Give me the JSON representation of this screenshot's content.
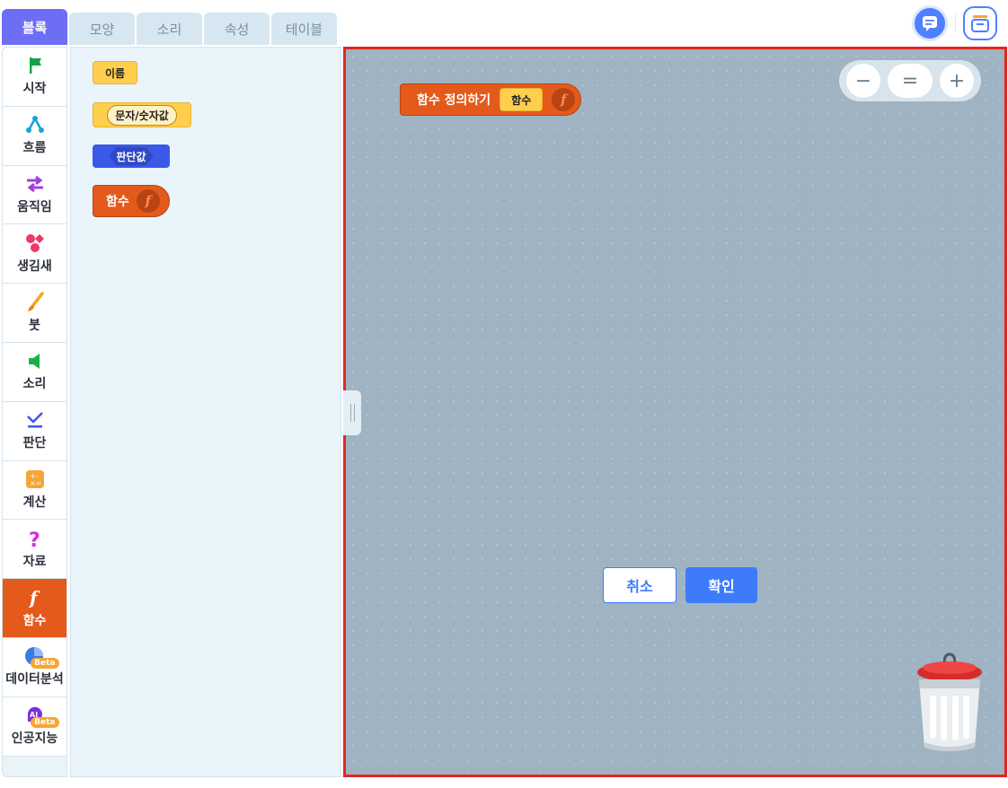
{
  "tabs": [
    {
      "label": "블록",
      "active": true
    },
    {
      "label": "모양"
    },
    {
      "label": "소리"
    },
    {
      "label": "속성"
    },
    {
      "label": "테이블"
    }
  ],
  "categories": [
    {
      "label": "시작",
      "icon": "flag-icon"
    },
    {
      "label": "흐름",
      "icon": "flow-icon"
    },
    {
      "label": "움직임",
      "icon": "arrows-icon"
    },
    {
      "label": "생김새",
      "icon": "shapes-icon"
    },
    {
      "label": "붓",
      "icon": "brush-icon"
    },
    {
      "label": "소리",
      "icon": "speaker-icon"
    },
    {
      "label": "판단",
      "icon": "check-icon"
    },
    {
      "label": "계산",
      "icon": "calculator-icon"
    },
    {
      "label": "자료",
      "icon": "question-icon"
    },
    {
      "label": "함수",
      "icon": "function-icon",
      "active": true
    },
    {
      "label": "데이터분석",
      "icon": "pie-chart-icon",
      "badge": "Beta"
    },
    {
      "label": "인공지능",
      "icon": "ai-head-icon",
      "badge": "Beta"
    }
  ],
  "palette": {
    "name_block": "이름",
    "string_block": "문자/숫자값",
    "boolean_block": "판단값",
    "function_block": "함수",
    "function_symbol": "f"
  },
  "workspace": {
    "define_block_label": "함수 정의하기",
    "define_block_name": "함수",
    "function_symbol": "f",
    "zoom_out": "−",
    "zoom_reset": "=",
    "zoom_in": "+",
    "cancel_label": "취소",
    "confirm_label": "확인"
  },
  "colors": {
    "accent": "#6e6ef5",
    "function": "#e35a1b",
    "workspace_bg": "#9fb3c2",
    "highlight_border": "#e3261e",
    "primary_button": "#3e7bfa"
  }
}
